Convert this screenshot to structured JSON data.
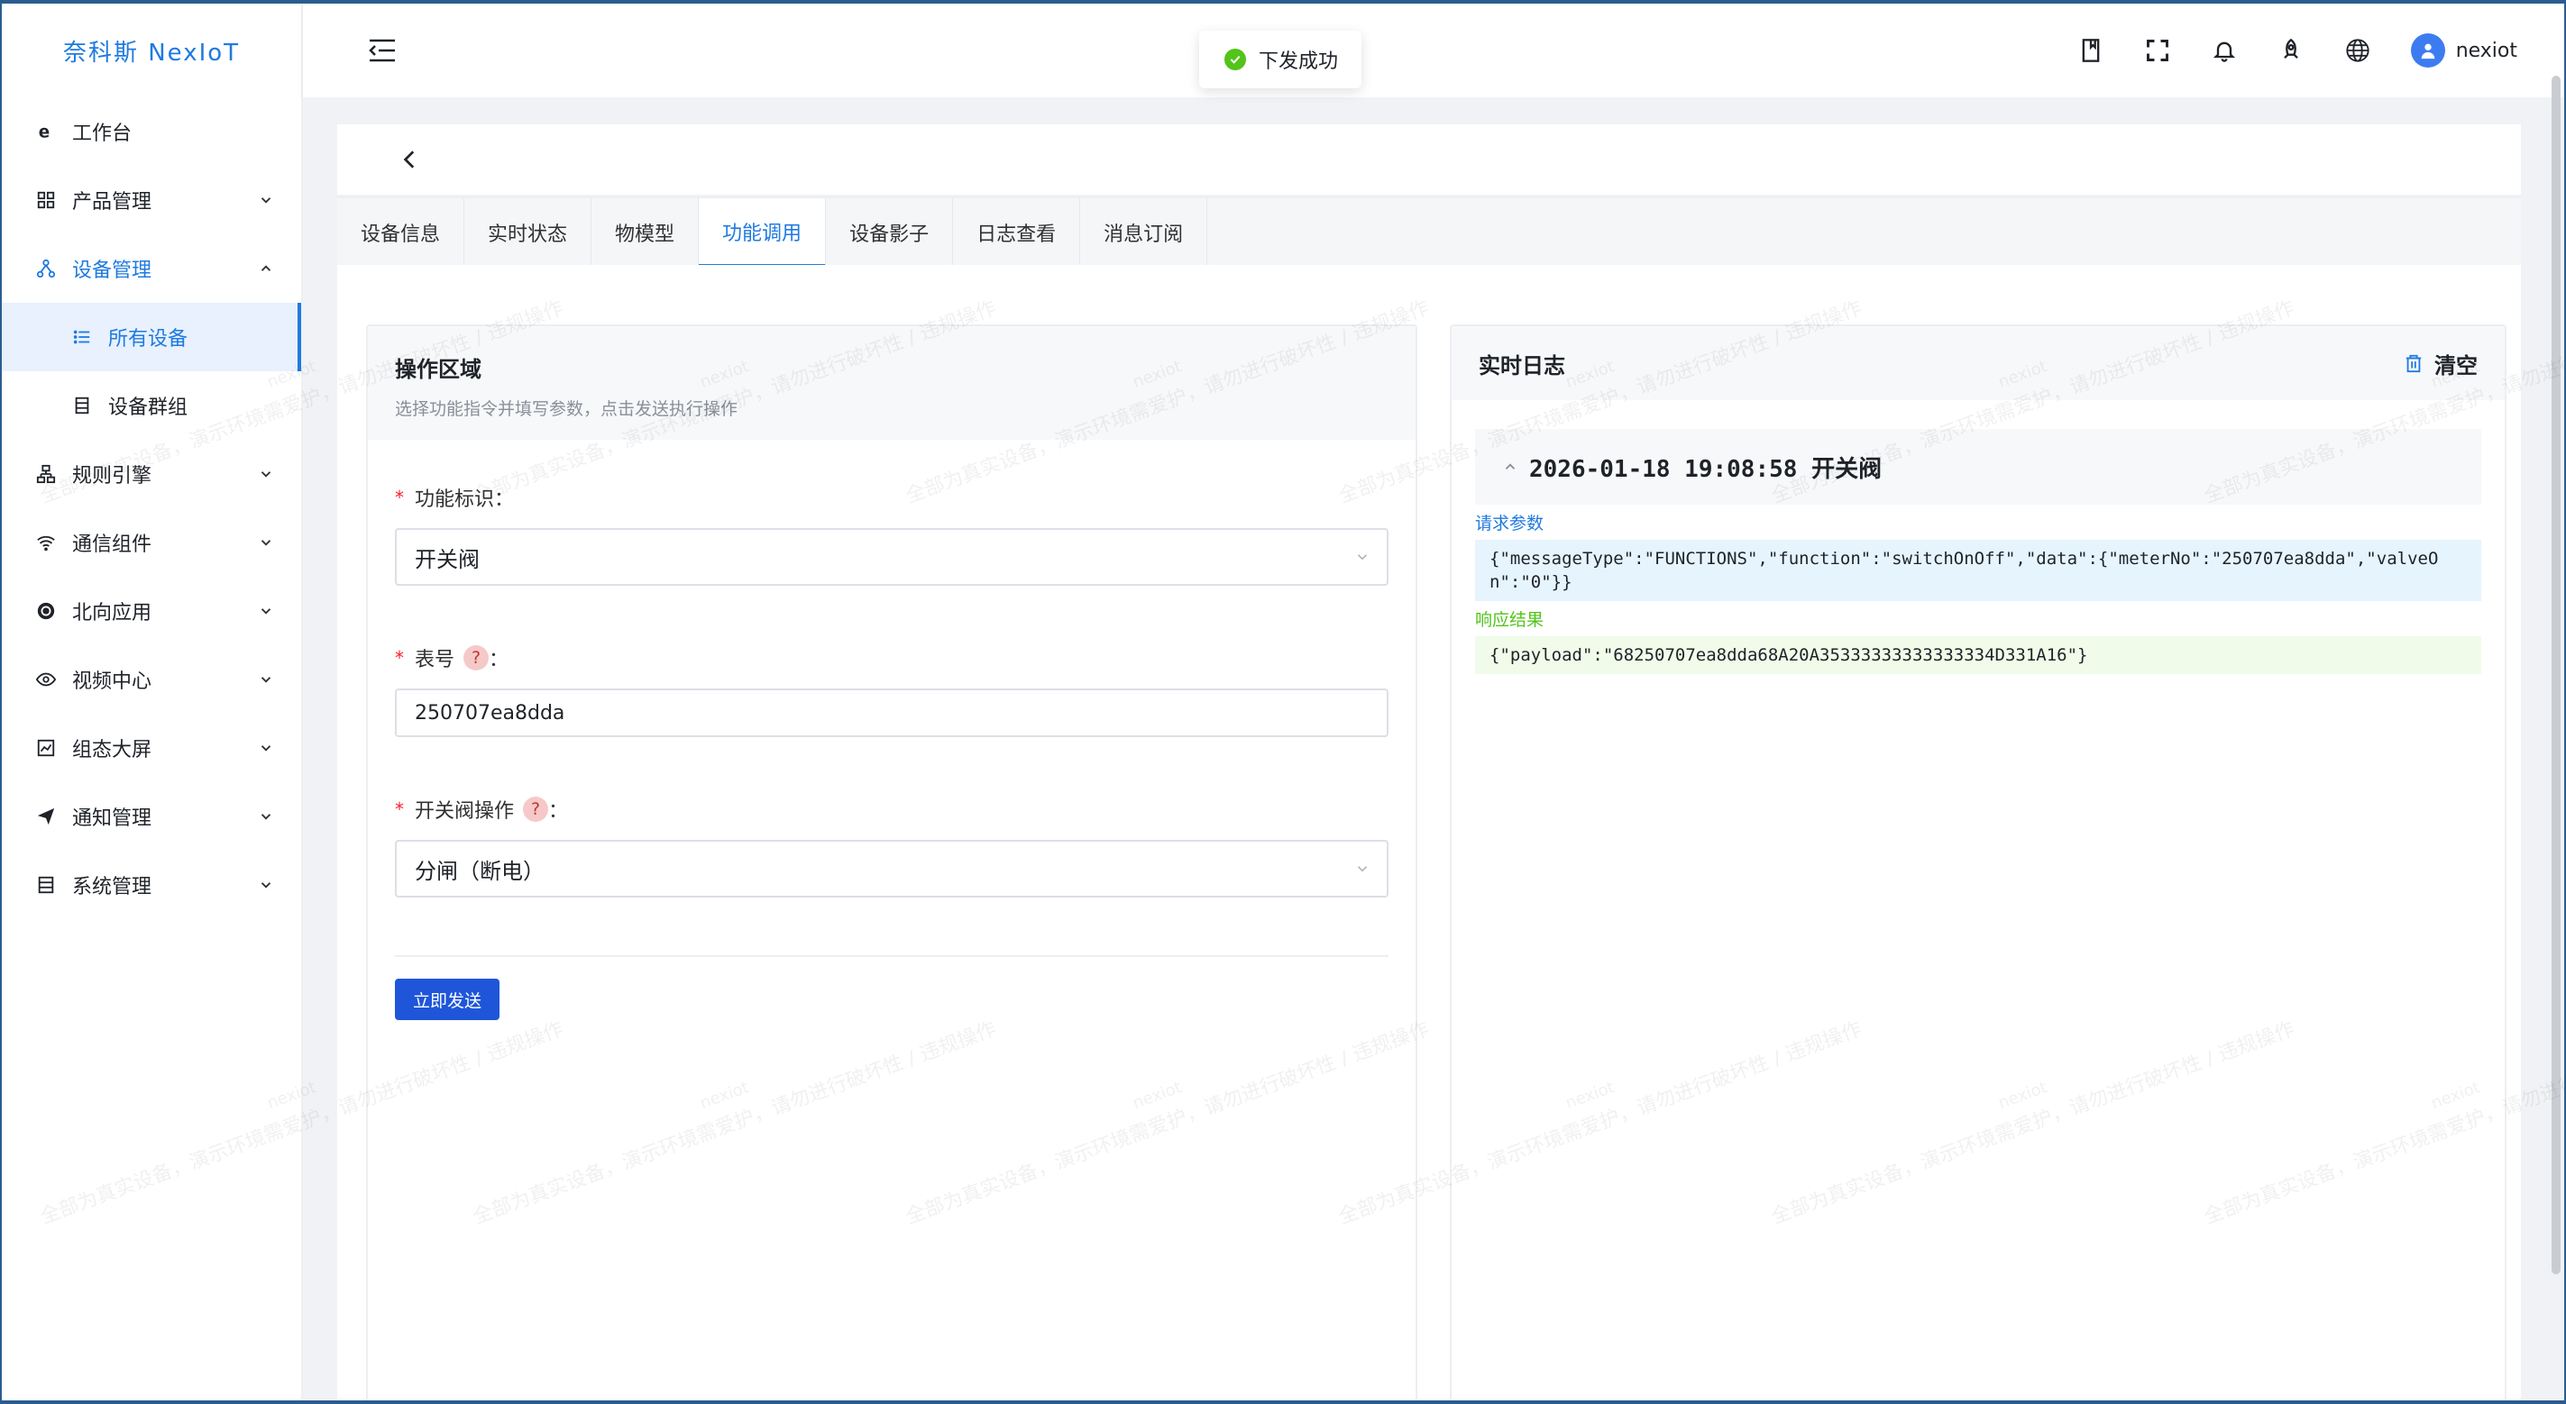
{
  "app": {
    "logo": "奈科斯 NexIoT"
  },
  "sidebar": {
    "items": [
      {
        "label": "工作台",
        "icon": "ie-icon"
      },
      {
        "label": "产品管理",
        "icon": "product-icon"
      },
      {
        "label": "设备管理",
        "icon": "device-icon"
      },
      {
        "label": "规则引擎",
        "icon": "rule-icon"
      },
      {
        "label": "通信组件",
        "icon": "wifi-icon"
      },
      {
        "label": "北向应用",
        "icon": "app-icon"
      },
      {
        "label": "视频中心",
        "icon": "eye-icon"
      },
      {
        "label": "组态大屏",
        "icon": "chart-icon"
      },
      {
        "label": "通知管理",
        "icon": "send-icon"
      },
      {
        "label": "系统管理",
        "icon": "system-icon"
      }
    ],
    "device_submenu": [
      {
        "label": "所有设备",
        "icon": "list-icon"
      },
      {
        "label": "设备群组",
        "icon": "group-icon"
      }
    ]
  },
  "header": {
    "username": "nexiot"
  },
  "toast": {
    "message": "下发成功"
  },
  "tabs": [
    "设备信息",
    "实时状态",
    "物模型",
    "功能调用",
    "设备影子",
    "日志查看",
    "消息订阅"
  ],
  "operation": {
    "title": "操作区域",
    "subtitle": "选择功能指令并填写参数，点击发送执行操作",
    "function_label": "功能标识",
    "function_value": "开关阀",
    "meter_label": "表号",
    "meter_value": "250707ea8dda",
    "valve_label": "开关阀操作",
    "valve_value": "分闸（断电）",
    "send_label": "立即发送"
  },
  "log": {
    "title": "实时日志",
    "clear_label": "清空",
    "entry_title": "2026-01-18 19:08:58 开关阀",
    "request_label": "请求参数",
    "request_body": "{\"messageType\":\"FUNCTIONS\",\"function\":\"switchOnOff\",\"data\":{\"meterNo\":\"250707ea8dda\",\"valveOn\":\"0\"}}",
    "response_label": "响应结果",
    "response_body": "{\"payload\":\"68250707ea8dda68A20A35333333333333334D331A16\"}"
  },
  "watermark": {
    "user": "nexiot",
    "text": "全部为真实设备，演示环境需爱护，请勿进行破坏性 / 违规操作"
  },
  "colors": {
    "primary": "#1f7ae0",
    "button": "#1f56d9",
    "success": "#52c41a",
    "required": "#f5222d"
  }
}
